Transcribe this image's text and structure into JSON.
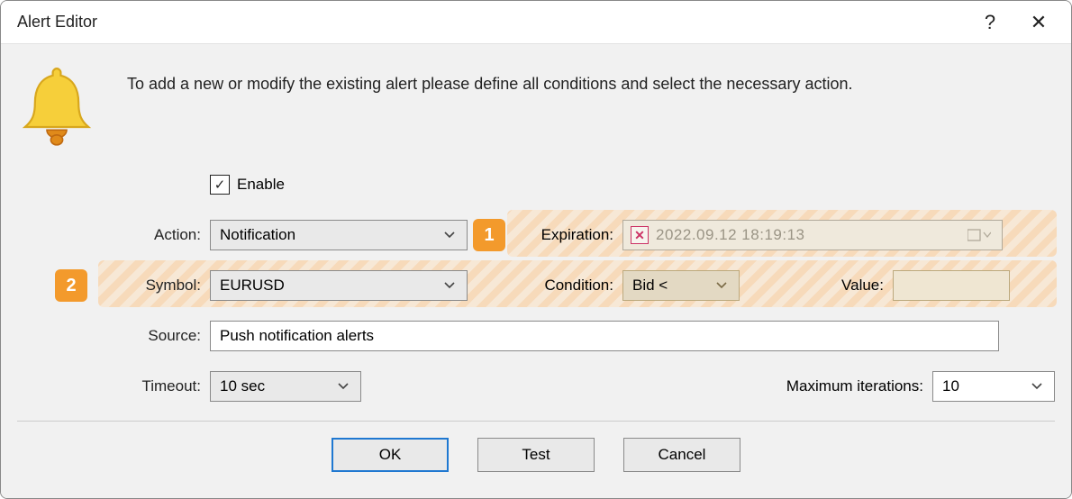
{
  "window": {
    "title": "Alert Editor",
    "help_symbol": "?",
    "close_symbol": "✕"
  },
  "intro": "To add a new or modify the existing alert please define all conditions and select the necessary action.",
  "callouts": {
    "one": "1",
    "two": "2"
  },
  "form": {
    "enable_label": "Enable",
    "enable_checked": true,
    "action": {
      "label": "Action:",
      "value": "Notification"
    },
    "expiration": {
      "label": "Expiration:",
      "value": "2022.09.12 18:19:13",
      "cleared": true
    },
    "symbol": {
      "label": "Symbol:",
      "value": "EURUSD"
    },
    "condition": {
      "label": "Condition:",
      "value": "Bid <"
    },
    "value": {
      "label": "Value:",
      "value": ""
    },
    "source": {
      "label": "Source:",
      "value": "Push notification alerts"
    },
    "timeout": {
      "label": "Timeout:",
      "value": "10 sec"
    },
    "max_iter": {
      "label": "Maximum iterations:",
      "value": "10"
    }
  },
  "buttons": {
    "ok": "OK",
    "test": "Test",
    "cancel": "Cancel"
  }
}
